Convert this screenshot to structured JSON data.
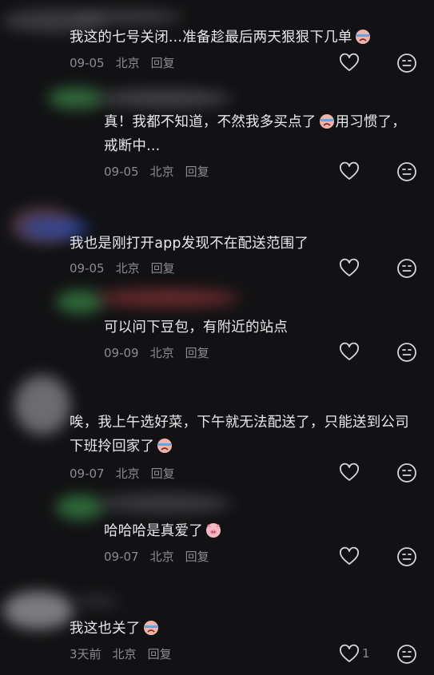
{
  "comments": [
    {
      "text": "我这的七号关闭...准备趁最后两天狠狠下几单",
      "emoji": "crying-face",
      "date": "09-05",
      "location": "北京",
      "reply": "回复"
    },
    {
      "text": "真！我都不知道，不然我多买点了",
      "text2": "用习惯了，戒断中...",
      "emoji": "crying-face",
      "date": "09-05",
      "location": "北京",
      "reply": "回复"
    },
    {
      "text": "我也是刚打开app发现不在配送范围了",
      "date": "09-05",
      "location": "北京",
      "reply": "回复"
    },
    {
      "text": "可以问下豆包，有附近的站点",
      "date": "09-09",
      "location": "北京",
      "reply": "回复"
    },
    {
      "text": "唉，我上午选好菜，下午就无法配送了，只能送到公司下班拎回家了",
      "emoji": "crying-face",
      "date": "09-07",
      "location": "北京",
      "reply": "回复"
    },
    {
      "text": "哈哈哈是真爱了",
      "emoji": "pig-face",
      "date": "09-07",
      "location": "北京",
      "reply": "回复"
    },
    {
      "text": "我这也关了",
      "emoji": "crying-face",
      "date": "3天前",
      "location": "北京",
      "reply": "回复",
      "likes": "1"
    }
  ]
}
